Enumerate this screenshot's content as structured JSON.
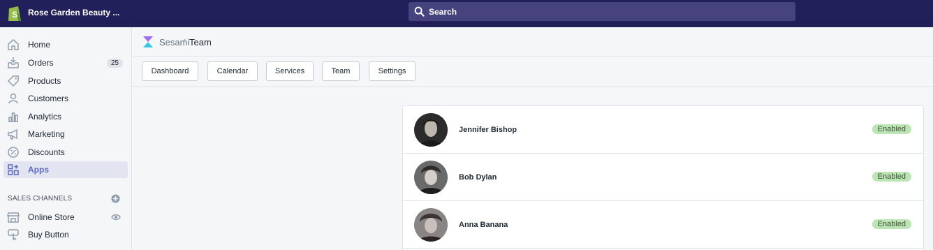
{
  "topbar": {
    "store_name": "Rose Garden Beauty ...",
    "search_placeholder": "Search"
  },
  "sidebar": {
    "items": [
      {
        "label": "Home",
        "icon": "home-icon"
      },
      {
        "label": "Orders",
        "icon": "orders-icon",
        "badge": "25"
      },
      {
        "label": "Products",
        "icon": "tag-icon"
      },
      {
        "label": "Customers",
        "icon": "person-icon"
      },
      {
        "label": "Analytics",
        "icon": "bar-chart-icon"
      },
      {
        "label": "Marketing",
        "icon": "megaphone-icon"
      },
      {
        "label": "Discounts",
        "icon": "discount-icon"
      },
      {
        "label": "Apps",
        "icon": "apps-icon",
        "active": true
      }
    ],
    "sales_channels_title": "SALES CHANNELS",
    "channels": [
      {
        "label": "Online Store",
        "icon": "store-icon"
      },
      {
        "label": "Buy Button",
        "icon": "buy-button-icon"
      }
    ]
  },
  "breadcrumb": {
    "app": "Sesami",
    "separator": "/",
    "page": "Team"
  },
  "tabs": [
    "Dashboard",
    "Calendar",
    "Services",
    "Team",
    "Settings"
  ],
  "team": [
    {
      "name": "Jennifer Bishop",
      "status": "Enabled"
    },
    {
      "name": "Bob Dylan",
      "status": "Enabled"
    },
    {
      "name": "Anna Banana",
      "status": "Enabled"
    }
  ],
  "colors": {
    "topbar": "#22205a",
    "search": "#47437f",
    "accent": "#5c6ac4",
    "enabled_badge": "#bbe5b3"
  }
}
